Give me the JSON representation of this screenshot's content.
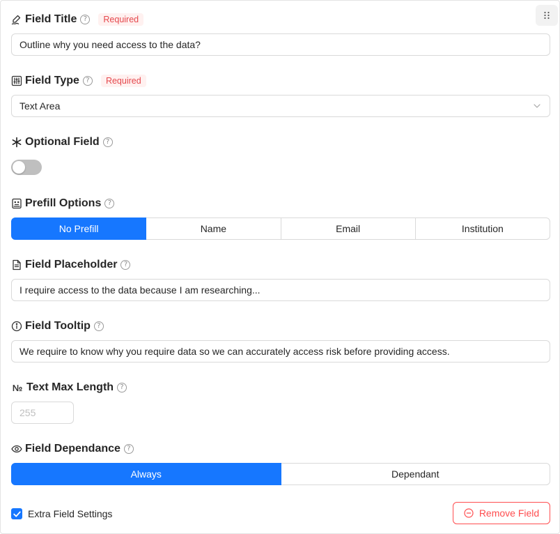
{
  "colors": {
    "primary": "#1677ff",
    "danger": "#ff4d4f",
    "required_bg": "#fff1f0",
    "required_text": "#e5484d",
    "border": "#d9d9d9"
  },
  "field_title": {
    "label": "Field Title",
    "help": "?",
    "badge": "Required",
    "value": "Outline why you need access to the data?"
  },
  "field_type": {
    "label": "Field Type",
    "help": "?",
    "badge": "Required",
    "value": "Text Area"
  },
  "optional_field": {
    "label": "Optional Field",
    "help": "?",
    "enabled": false
  },
  "prefill": {
    "label": "Prefill Options",
    "help": "?",
    "options": [
      "No Prefill",
      "Name",
      "Email",
      "Institution"
    ],
    "selected": "No Prefill"
  },
  "placeholder": {
    "label": "Field Placeholder",
    "help": "?",
    "value": "I require access to the data because I am researching..."
  },
  "tooltip": {
    "label": "Field Tooltip",
    "help": "?",
    "value": "We require to know why you require data so we can accurately access risk before providing access."
  },
  "max_length": {
    "icon_text": "№",
    "label": "Text Max Length",
    "help": "?",
    "placeholder": "255"
  },
  "dependance": {
    "label": "Field Dependance",
    "help": "?",
    "options": [
      "Always",
      "Dependant"
    ],
    "selected": "Always"
  },
  "footer": {
    "extra_settings_label": "Extra Field Settings",
    "extra_settings_checked": true,
    "remove_label": "Remove Field"
  },
  "icons": {
    "drag": "drag-dots-icon",
    "title": "signature-pen-icon",
    "type": "sliders-icon",
    "optional": "asterisk-icon",
    "prefill": "form-face-icon",
    "placeholder": "document-icon",
    "tooltip": "info-icon",
    "dependance": "eye-icon",
    "remove": "minus-circle-icon"
  }
}
